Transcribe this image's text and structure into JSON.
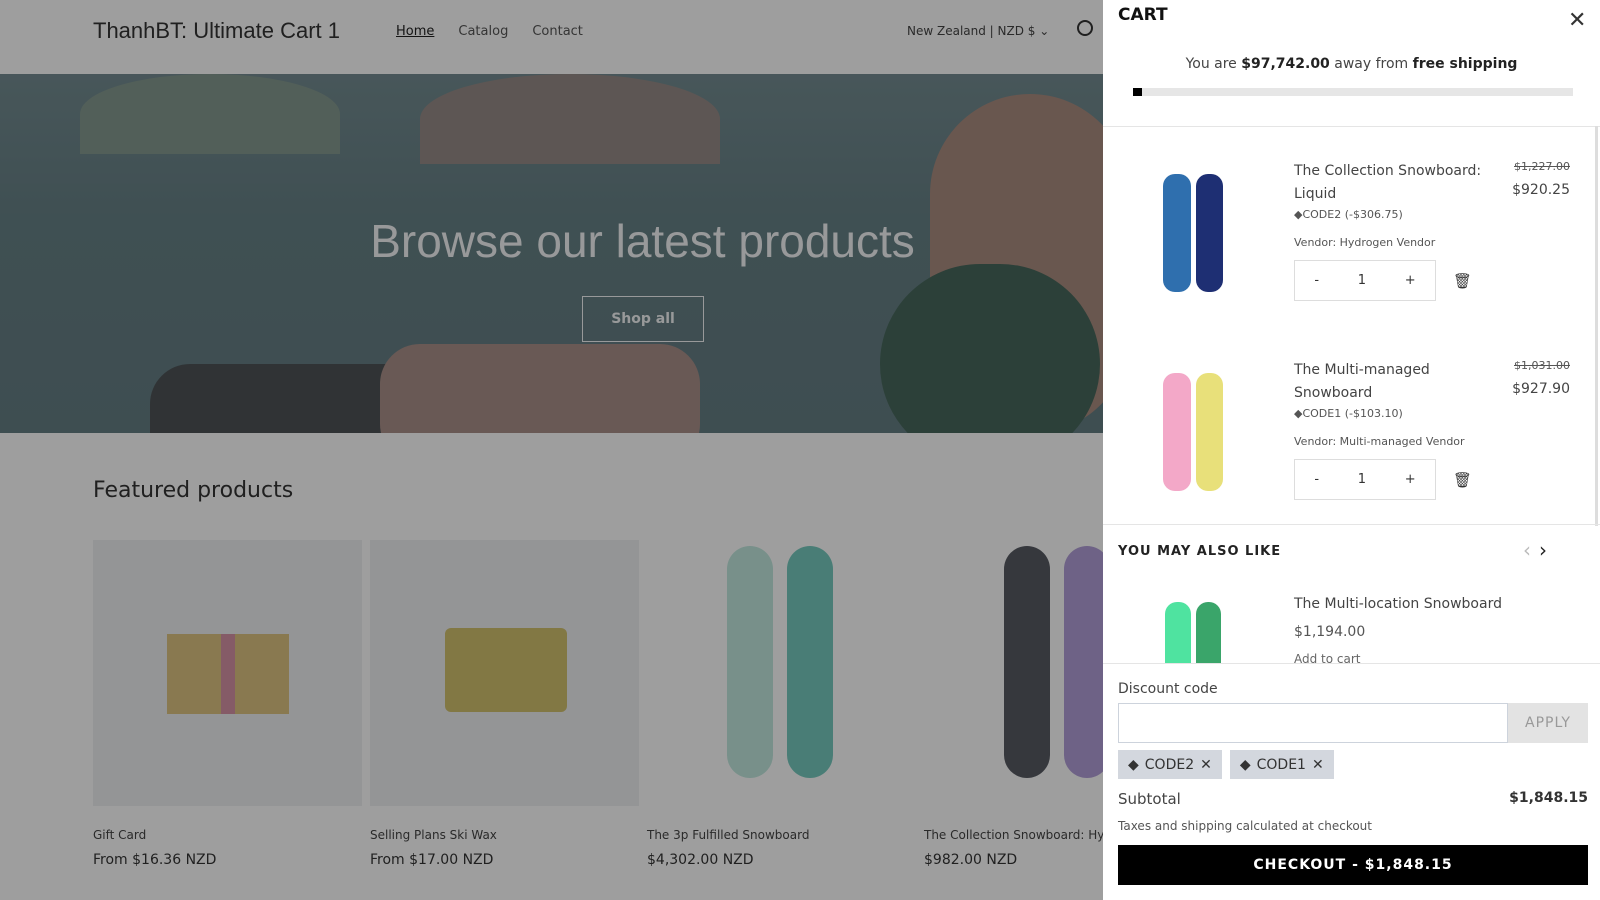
{
  "store": {
    "logo": "ThanhBT: Ultimate Cart 1",
    "nav": [
      "Home",
      "Catalog",
      "Contact"
    ],
    "region": "New Zealand | NZD $ ⌄"
  },
  "hero": {
    "title": "Browse our latest products",
    "button": "Shop all"
  },
  "featured": {
    "title": "Featured products",
    "products": [
      {
        "name": "Gift Card",
        "price": "From $16.36 NZD"
      },
      {
        "name": "Selling Plans Ski Wax",
        "price": "From $17.00 NZD"
      },
      {
        "name": "The 3p Fulfilled Snowboard",
        "price": "$4,302.00 NZD"
      },
      {
        "name": "The Collection Snowboard: Hydrogen",
        "price": "$982.00 NZD"
      }
    ]
  },
  "cart": {
    "title": "CART",
    "close": "✕",
    "shipping": {
      "prefix": "You are ",
      "amount": "$97,742.00",
      "middle": " away from ",
      "suffix": "free shipping",
      "progress_percent": 2
    },
    "items": [
      {
        "name": "The Collection Snowboard: Liquid",
        "code": "◆CODE2  (-$306.75)",
        "vendor": "Vendor: Hydrogen Vendor",
        "old_price": "$1,227.00",
        "price": "$920.25",
        "qty": "1",
        "colors": [
          "#2f6fae",
          "#1e2f73"
        ]
      },
      {
        "name": "The Multi-managed Snowboard",
        "code": "◆CODE1  (-$103.10)",
        "vendor": "Vendor: Multi-managed Vendor",
        "old_price": "$1,031.00",
        "price": "$927.90",
        "qty": "1",
        "colors": [
          "#f3a8c8",
          "#e8e07a"
        ]
      }
    ],
    "minus": "-",
    "plus": "+",
    "trash": "🗑",
    "also_like": {
      "title": "YOU MAY ALSO LIKE",
      "prev": "‹",
      "next": "›",
      "item": {
        "name": "The Multi-location Snowboard",
        "price": "$1,194.00",
        "add": "Add to cart"
      }
    },
    "discount": {
      "label": "Discount code",
      "placeholder": "",
      "apply": "APPLY",
      "codes": [
        "CODE2",
        "CODE1"
      ]
    },
    "subtotal_label": "Subtotal",
    "subtotal": "$1,848.15",
    "tax_note": "Taxes and shipping calculated at checkout",
    "checkout": "CHECKOUT - $1,848.15"
  }
}
